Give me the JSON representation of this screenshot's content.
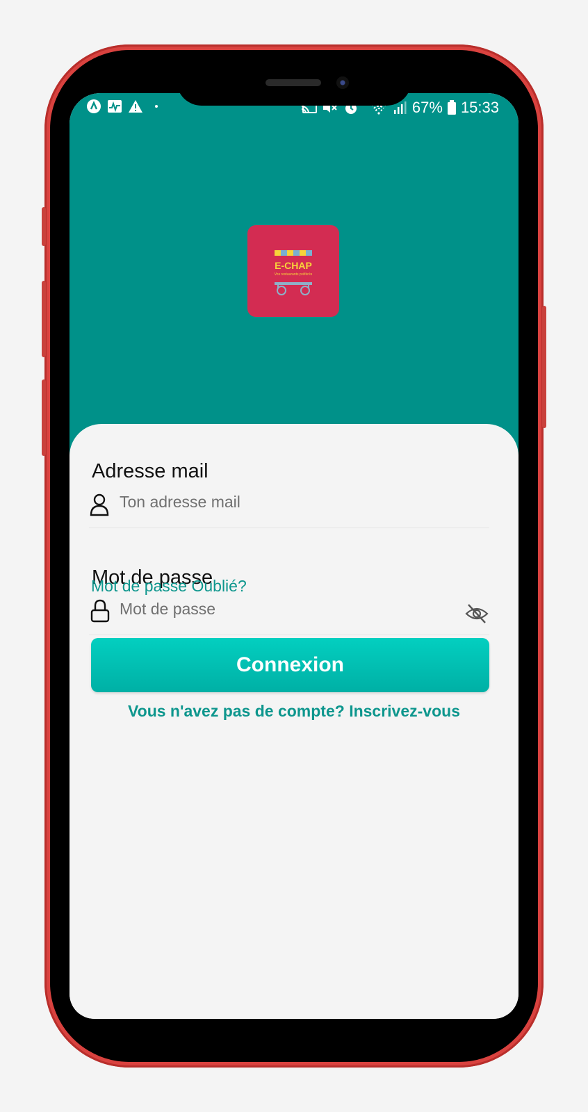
{
  "status_bar": {
    "battery": "67%",
    "time": "15:33",
    "left_icons": [
      "app-icon",
      "activity-icon",
      "warning-icon",
      "dot-icon"
    ],
    "right_icons": [
      "cast-icon",
      "mute-icon",
      "alarm-icon",
      "wifi-icon",
      "signal-icon",
      "battery-icon"
    ]
  },
  "logo": {
    "title": "E-CHAP",
    "subtitle": "Vos restaurants préférés",
    "bg_color": "#d32c52",
    "text_color": "#f7d33a"
  },
  "email": {
    "label": "Adresse mail",
    "placeholder": "Ton adresse mail",
    "icon": "user-icon"
  },
  "password": {
    "label": "Mot de passe",
    "placeholder": "Mot de passe",
    "icon": "lock-icon",
    "toggle_icon": "eye-off-icon"
  },
  "forgot_link": "Mot de passe Oublié?",
  "login_button": "Connexion",
  "signup_link": "Vous n'avez pas de compte? Inscrivez-vous",
  "colors": {
    "header": "#009189",
    "accent": "#0d968d",
    "button": "#03cfc0"
  }
}
